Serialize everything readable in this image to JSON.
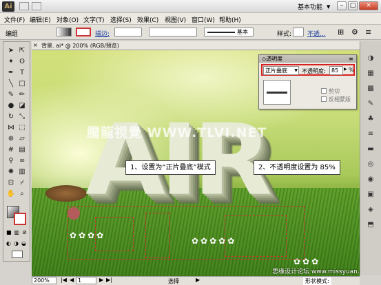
{
  "app": {
    "logo": "Ai",
    "workspace": "基本功能",
    "win_min": "–",
    "win_max": "□",
    "win_close": "×"
  },
  "menu": [
    "文件(F)",
    "编辑(E)",
    "对象(O)",
    "文字(T)",
    "选择(S)",
    "效果(C)",
    "视图(V)",
    "窗口(W)",
    "帮助(H)"
  ],
  "control": {
    "group_label": "编组",
    "stroke_label": "描边:",
    "style_name": "基本",
    "style_label": "样式:",
    "opacity_label": "不透..."
  },
  "doc": {
    "tab": "背景. ai* @ 200% (RGB/预览)"
  },
  "canvas": {
    "big_text": "AIR",
    "watermark": "騰龍視覺 WWW.TLVI.NET",
    "callout1": "1、设置为“正片叠底”模式",
    "callout2": "2、不透明度设置为 85%",
    "bottom_watermark": "思缘设计论坛 www.missyuan.com"
  },
  "transparency": {
    "title": "◇透明度",
    "blend_mode": "正片叠底",
    "opacity_label": "不透明度:",
    "opacity_value": "85",
    "opacity_unit": "%",
    "clip": "剪切",
    "invert_mask": "反相蒙版"
  },
  "status": {
    "zoom": "200%",
    "page": "1",
    "tool": "选择",
    "shape_mode": "形状模式:"
  },
  "colors": {
    "highlight": "#d81f1f"
  }
}
